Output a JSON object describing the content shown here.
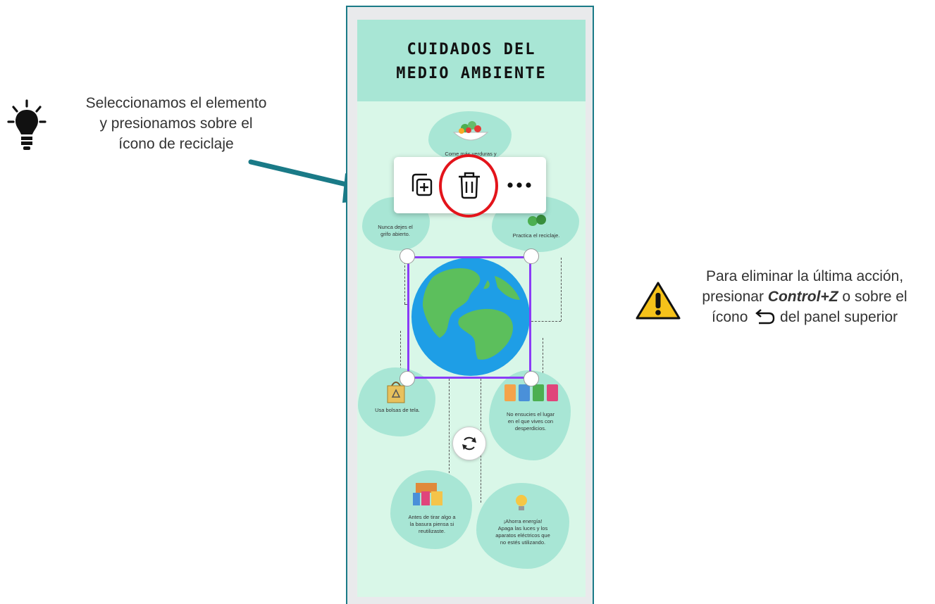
{
  "tip": {
    "lines": [
      "Seleccionamos el elemento",
      "y presionamos sobre el",
      "ícono de reciclaje"
    ],
    "icon": "lightbulb-icon"
  },
  "warning": {
    "line1": "Para eliminar la última acción,",
    "line2_pre": "presionar ",
    "line2_key": "Control+Z",
    "line2_post": " o sobre el",
    "line3_pre": "ícono ",
    "line3_post": " del panel superior",
    "icon": "warning-icon",
    "undo_icon": "undo-icon"
  },
  "poster": {
    "title_lines": [
      "CUIDADOS DEL",
      "MEDIO AMBIENTE"
    ],
    "tips": {
      "vegetables": "Come más verduras y",
      "water": [
        "Nunca dejes el",
        "grifo abierto."
      ],
      "recycle": "Practica el reciclaje.",
      "bags": "Usa bolsas de tela.",
      "litter": [
        "No ensucies el lugar",
        "en el que vives con",
        "desperdicios."
      ],
      "reuse": [
        "Antes de tirar algo a",
        "la basura piensa si",
        "reutilizaste."
      ],
      "energy": [
        "¡Ahorra energía!",
        "Apaga las luces y los",
        "aparatos eléctricos que",
        "no estés utilizando."
      ]
    }
  },
  "toolbar": {
    "items": [
      "copy-icon",
      "trash-icon",
      "more-icon"
    ]
  },
  "colors": {
    "accent_frame": "#1a7a87",
    "highlight": "#e3141b",
    "selection": "#8b3cf7",
    "poster_bg": "#d9f7e8",
    "poster_header": "#a8e6d5"
  }
}
